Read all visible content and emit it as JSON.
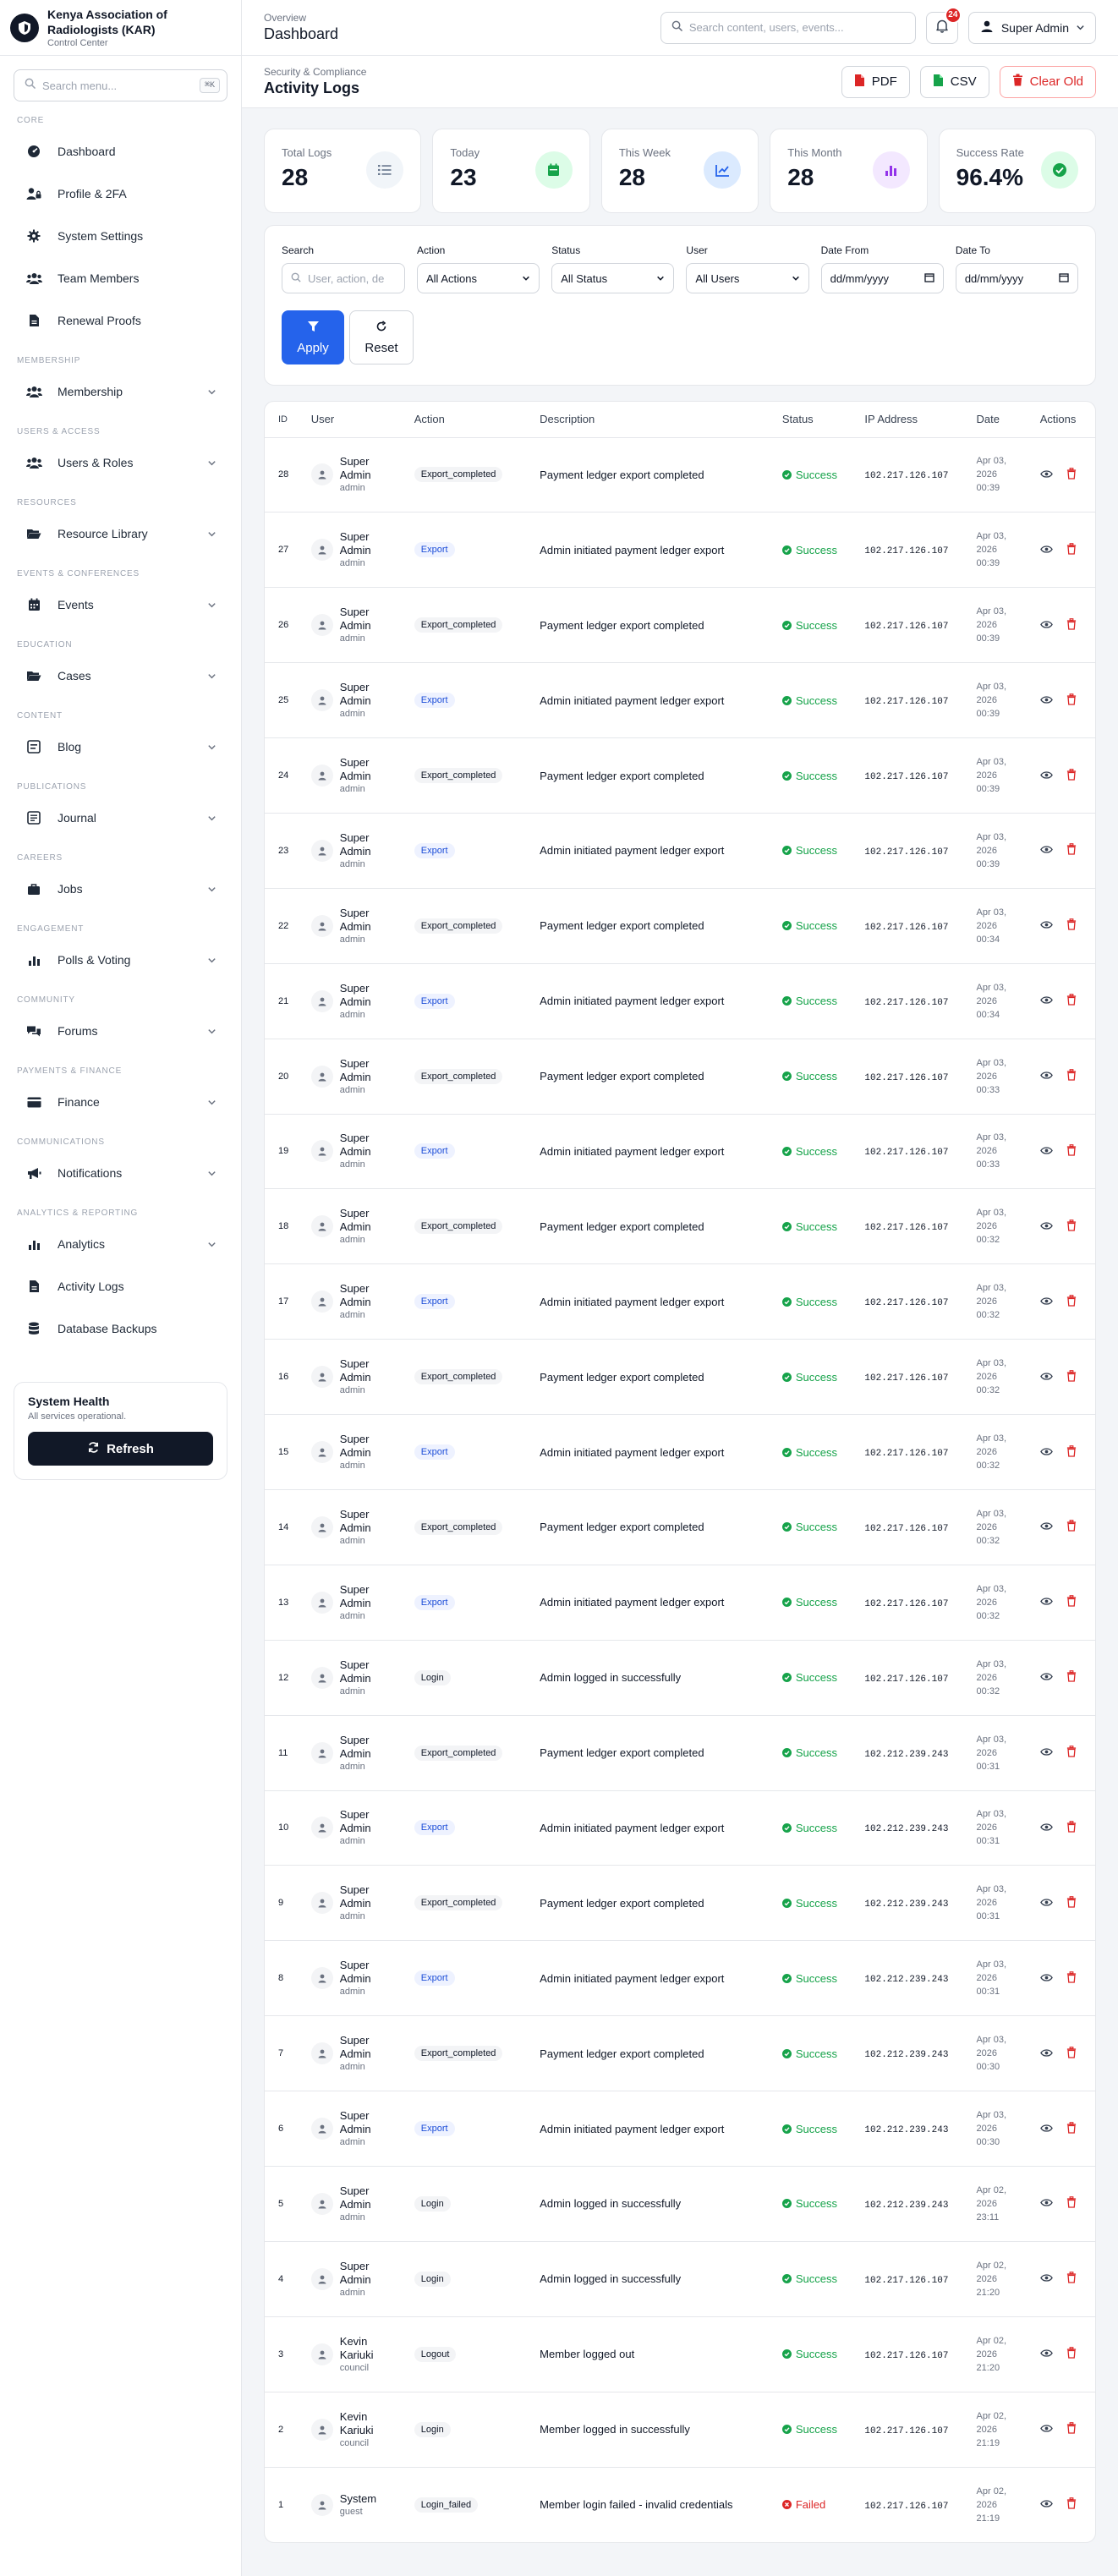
{
  "brand": {
    "name": "Kenya Association of Radiologists (KAR)",
    "subtitle": "Control Center"
  },
  "sidebar": {
    "search_placeholder": "Search menu...",
    "search_shortcut": "⌘K",
    "sections": [
      {
        "title": "CORE",
        "items": [
          {
            "label": "Dashboard",
            "icon": "gauge-icon",
            "expandable": false
          },
          {
            "label": "Profile & 2FA",
            "icon": "user-lock-icon",
            "expandable": false
          },
          {
            "label": "System Settings",
            "icon": "gear-icon",
            "expandable": false
          },
          {
            "label": "Team Members",
            "icon": "users-icon",
            "expandable": false
          },
          {
            "label": "Renewal Proofs",
            "icon": "document-icon",
            "expandable": false
          }
        ]
      },
      {
        "title": "MEMBERSHIP",
        "items": [
          {
            "label": "Membership",
            "icon": "users-icon",
            "expandable": true
          }
        ]
      },
      {
        "title": "USERS & ACCESS",
        "items": [
          {
            "label": "Users & Roles",
            "icon": "users-icon",
            "expandable": true
          }
        ]
      },
      {
        "title": "RESOURCES",
        "items": [
          {
            "label": "Resource Library",
            "icon": "folder-icon",
            "expandable": true
          }
        ]
      },
      {
        "title": "EVENTS & CONFERENCES",
        "items": [
          {
            "label": "Events",
            "icon": "calendar-icon",
            "expandable": true
          }
        ]
      },
      {
        "title": "EDUCATION",
        "items": [
          {
            "label": "Cases",
            "icon": "folder-icon",
            "expandable": true
          }
        ]
      },
      {
        "title": "CONTENT",
        "items": [
          {
            "label": "Blog",
            "icon": "blog-icon",
            "expandable": true
          }
        ]
      },
      {
        "title": "PUBLICATIONS",
        "items": [
          {
            "label": "Journal",
            "icon": "journal-icon",
            "expandable": true
          }
        ]
      },
      {
        "title": "CAREERS",
        "items": [
          {
            "label": "Jobs",
            "icon": "briefcase-icon",
            "expandable": true
          }
        ]
      },
      {
        "title": "ENGAGEMENT",
        "items": [
          {
            "label": "Polls & Voting",
            "icon": "bar-chart-icon",
            "expandable": true
          }
        ]
      },
      {
        "title": "COMMUNITY",
        "items": [
          {
            "label": "Forums",
            "icon": "comments-icon",
            "expandable": true
          }
        ]
      },
      {
        "title": "PAYMENTS & FINANCE",
        "items": [
          {
            "label": "Finance",
            "icon": "card-icon",
            "expandable": true
          }
        ]
      },
      {
        "title": "COMMUNICATIONS",
        "items": [
          {
            "label": "Notifications",
            "icon": "megaphone-icon",
            "expandable": true
          }
        ]
      },
      {
        "title": "ANALYTICS & REPORTING",
        "items": [
          {
            "label": "Analytics",
            "icon": "bar-chart-icon",
            "expandable": true
          },
          {
            "label": "Activity Logs",
            "icon": "document-icon",
            "expandable": false
          },
          {
            "label": "Database Backups",
            "icon": "database-icon",
            "expandable": false
          }
        ]
      }
    ],
    "health": {
      "title": "System Health",
      "status": "All services operational.",
      "button": "Refresh"
    }
  },
  "topbar": {
    "overline": "Overview",
    "title": "Dashboard",
    "search_placeholder": "Search content, users, events...",
    "notification_count": "24",
    "user_name": "Super Admin"
  },
  "page": {
    "breadcrumb": "Security & Compliance",
    "title": "Activity Logs",
    "export_pdf": "PDF",
    "export_csv": "CSV",
    "clear_old": "Clear Old"
  },
  "stats": [
    {
      "label": "Total Logs",
      "value": "28",
      "icon": "list-icon",
      "color": "#64748b",
      "bg": "#f1f5f9"
    },
    {
      "label": "Today",
      "value": "23",
      "icon": "calendar-icon",
      "color": "#16a34a",
      "bg": "#dcfce7"
    },
    {
      "label": "This Week",
      "value": "28",
      "icon": "trend-icon",
      "color": "#2563eb",
      "bg": "#dbeafe"
    },
    {
      "label": "This Month",
      "value": "28",
      "icon": "bar-chart-icon",
      "color": "#9333ea",
      "bg": "#f3e8ff"
    },
    {
      "label": "Success Rate",
      "value": "96.4%",
      "icon": "check-circle-icon",
      "color": "#16a34a",
      "bg": "#dcfce7"
    }
  ],
  "filters": {
    "search_label": "Search",
    "search_placeholder": "User, action, de",
    "action_label": "Action",
    "action_value": "All Actions",
    "status_label": "Status",
    "status_value": "All Status",
    "user_label": "User",
    "user_value": "All Users",
    "date_from_label": "Date From",
    "date_from_value": "dd/mm/yyyy",
    "date_to_label": "Date To",
    "date_to_value": "dd/mm/yyyy",
    "apply": "Apply",
    "reset": "Reset"
  },
  "table": {
    "headers": [
      "ID",
      "User",
      "Action",
      "Description",
      "Status",
      "IP Address",
      "Date",
      "Actions"
    ],
    "rows": [
      {
        "id": "28",
        "user": "Super Admin",
        "role": "admin",
        "action": "Export_completed",
        "description": "Payment ledger export completed",
        "status": "Success",
        "ip": "102.217.126.107",
        "date": "Apr 03, 2026 00:39"
      },
      {
        "id": "27",
        "user": "Super Admin",
        "role": "admin",
        "action": "Export",
        "description": "Admin initiated payment ledger export",
        "status": "Success",
        "ip": "102.217.126.107",
        "date": "Apr 03, 2026 00:39"
      },
      {
        "id": "26",
        "user": "Super Admin",
        "role": "admin",
        "action": "Export_completed",
        "description": "Payment ledger export completed",
        "status": "Success",
        "ip": "102.217.126.107",
        "date": "Apr 03, 2026 00:39"
      },
      {
        "id": "25",
        "user": "Super Admin",
        "role": "admin",
        "action": "Export",
        "description": "Admin initiated payment ledger export",
        "status": "Success",
        "ip": "102.217.126.107",
        "date": "Apr 03, 2026 00:39"
      },
      {
        "id": "24",
        "user": "Super Admin",
        "role": "admin",
        "action": "Export_completed",
        "description": "Payment ledger export completed",
        "status": "Success",
        "ip": "102.217.126.107",
        "date": "Apr 03, 2026 00:39"
      },
      {
        "id": "23",
        "user": "Super Admin",
        "role": "admin",
        "action": "Export",
        "description": "Admin initiated payment ledger export",
        "status": "Success",
        "ip": "102.217.126.107",
        "date": "Apr 03, 2026 00:39"
      },
      {
        "id": "22",
        "user": "Super Admin",
        "role": "admin",
        "action": "Export_completed",
        "description": "Payment ledger export completed",
        "status": "Success",
        "ip": "102.217.126.107",
        "date": "Apr 03, 2026 00:34"
      },
      {
        "id": "21",
        "user": "Super Admin",
        "role": "admin",
        "action": "Export",
        "description": "Admin initiated payment ledger export",
        "status": "Success",
        "ip": "102.217.126.107",
        "date": "Apr 03, 2026 00:34"
      },
      {
        "id": "20",
        "user": "Super Admin",
        "role": "admin",
        "action": "Export_completed",
        "description": "Payment ledger export completed",
        "status": "Success",
        "ip": "102.217.126.107",
        "date": "Apr 03, 2026 00:33"
      },
      {
        "id": "19",
        "user": "Super Admin",
        "role": "admin",
        "action": "Export",
        "description": "Admin initiated payment ledger export",
        "status": "Success",
        "ip": "102.217.126.107",
        "date": "Apr 03, 2026 00:33"
      },
      {
        "id": "18",
        "user": "Super Admin",
        "role": "admin",
        "action": "Export_completed",
        "description": "Payment ledger export completed",
        "status": "Success",
        "ip": "102.217.126.107",
        "date": "Apr 03, 2026 00:32"
      },
      {
        "id": "17",
        "user": "Super Admin",
        "role": "admin",
        "action": "Export",
        "description": "Admin initiated payment ledger export",
        "status": "Success",
        "ip": "102.217.126.107",
        "date": "Apr 03, 2026 00:32"
      },
      {
        "id": "16",
        "user": "Super Admin",
        "role": "admin",
        "action": "Export_completed",
        "description": "Payment ledger export completed",
        "status": "Success",
        "ip": "102.217.126.107",
        "date": "Apr 03, 2026 00:32"
      },
      {
        "id": "15",
        "user": "Super Admin",
        "role": "admin",
        "action": "Export",
        "description": "Admin initiated payment ledger export",
        "status": "Success",
        "ip": "102.217.126.107",
        "date": "Apr 03, 2026 00:32"
      },
      {
        "id": "14",
        "user": "Super Admin",
        "role": "admin",
        "action": "Export_completed",
        "description": "Payment ledger export completed",
        "status": "Success",
        "ip": "102.217.126.107",
        "date": "Apr 03, 2026 00:32"
      },
      {
        "id": "13",
        "user": "Super Admin",
        "role": "admin",
        "action": "Export",
        "description": "Admin initiated payment ledger export",
        "status": "Success",
        "ip": "102.217.126.107",
        "date": "Apr 03, 2026 00:32"
      },
      {
        "id": "12",
        "user": "Super Admin",
        "role": "admin",
        "action": "Login",
        "description": "Admin logged in successfully",
        "status": "Success",
        "ip": "102.217.126.107",
        "date": "Apr 03, 2026 00:32"
      },
      {
        "id": "11",
        "user": "Super Admin",
        "role": "admin",
        "action": "Export_completed",
        "description": "Payment ledger export completed",
        "status": "Success",
        "ip": "102.212.239.243",
        "date": "Apr 03, 2026 00:31"
      },
      {
        "id": "10",
        "user": "Super Admin",
        "role": "admin",
        "action": "Export",
        "description": "Admin initiated payment ledger export",
        "status": "Success",
        "ip": "102.212.239.243",
        "date": "Apr 03, 2026 00:31"
      },
      {
        "id": "9",
        "user": "Super Admin",
        "role": "admin",
        "action": "Export_completed",
        "description": "Payment ledger export completed",
        "status": "Success",
        "ip": "102.212.239.243",
        "date": "Apr 03, 2026 00:31"
      },
      {
        "id": "8",
        "user": "Super Admin",
        "role": "admin",
        "action": "Export",
        "description": "Admin initiated payment ledger export",
        "status": "Success",
        "ip": "102.212.239.243",
        "date": "Apr 03, 2026 00:31"
      },
      {
        "id": "7",
        "user": "Super Admin",
        "role": "admin",
        "action": "Export_completed",
        "description": "Payment ledger export completed",
        "status": "Success",
        "ip": "102.212.239.243",
        "date": "Apr 03, 2026 00:30"
      },
      {
        "id": "6",
        "user": "Super Admin",
        "role": "admin",
        "action": "Export",
        "description": "Admin initiated payment ledger export",
        "status": "Success",
        "ip": "102.212.239.243",
        "date": "Apr 03, 2026 00:30"
      },
      {
        "id": "5",
        "user": "Super Admin",
        "role": "admin",
        "action": "Login",
        "description": "Admin logged in successfully",
        "status": "Success",
        "ip": "102.212.239.243",
        "date": "Apr 02, 2026 23:11"
      },
      {
        "id": "4",
        "user": "Super Admin",
        "role": "admin",
        "action": "Login",
        "description": "Admin logged in successfully",
        "status": "Success",
        "ip": "102.217.126.107",
        "date": "Apr 02, 2026 21:20"
      },
      {
        "id": "3",
        "user": "Kevin Kariuki",
        "role": "council",
        "action": "Logout",
        "description": "Member logged out",
        "status": "Success",
        "ip": "102.217.126.107",
        "date": "Apr 02, 2026 21:20"
      },
      {
        "id": "2",
        "user": "Kevin Kariuki",
        "role": "council",
        "action": "Login",
        "description": "Member logged in successfully",
        "status": "Success",
        "ip": "102.217.126.107",
        "date": "Apr 02, 2026 21:19"
      },
      {
        "id": "1",
        "user": "System",
        "role": "guest",
        "action": "Login_failed",
        "description": "Member login failed - invalid credentials",
        "status": "Failed",
        "ip": "102.217.126.107",
        "date": "Apr 02, 2026 21:19"
      }
    ]
  },
  "colors": {
    "primary": "#2563eb",
    "success": "#16a34a",
    "danger": "#dc2626",
    "dark": "#111827"
  }
}
